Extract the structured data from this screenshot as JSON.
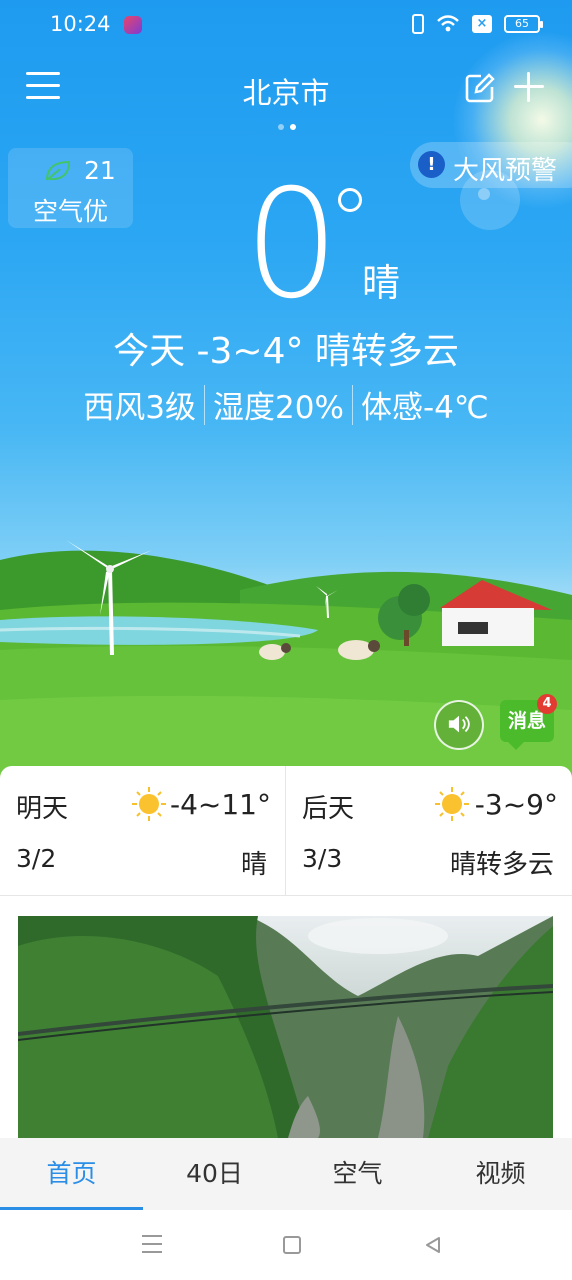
{
  "status_bar": {
    "time": "10:24",
    "battery": "65"
  },
  "header": {
    "city": "北京市"
  },
  "aqi": {
    "value": "21",
    "label": "空气优"
  },
  "alert": {
    "icon": "!",
    "label": "大风预警"
  },
  "current": {
    "temperature": "0",
    "condition": "晴",
    "today_summary": "今天 -3~4° 晴转多云",
    "wind": "西风3级",
    "humidity": "湿度20%",
    "feels_like": "体感-4℃"
  },
  "message_button": {
    "label": "消息",
    "badge": "4"
  },
  "forecast": [
    {
      "day": "明天",
      "temp": "-4~11°",
      "date": "3/2",
      "condition": "晴",
      "icon": "sun-icon"
    },
    {
      "day": "后天",
      "temp": "-3~9°",
      "date": "3/3",
      "condition": "晴转多云",
      "icon": "sun-icon"
    }
  ],
  "tabs": [
    {
      "label": "首页",
      "active": true
    },
    {
      "label": "40日",
      "active": false
    },
    {
      "label": "空气",
      "active": false
    },
    {
      "label": "视频",
      "active": false
    }
  ],
  "colors": {
    "sky_top": "#1e9bf0",
    "accent": "#2a8ee6",
    "message_green": "#4bbb2b",
    "badge_red": "#e23b32"
  }
}
